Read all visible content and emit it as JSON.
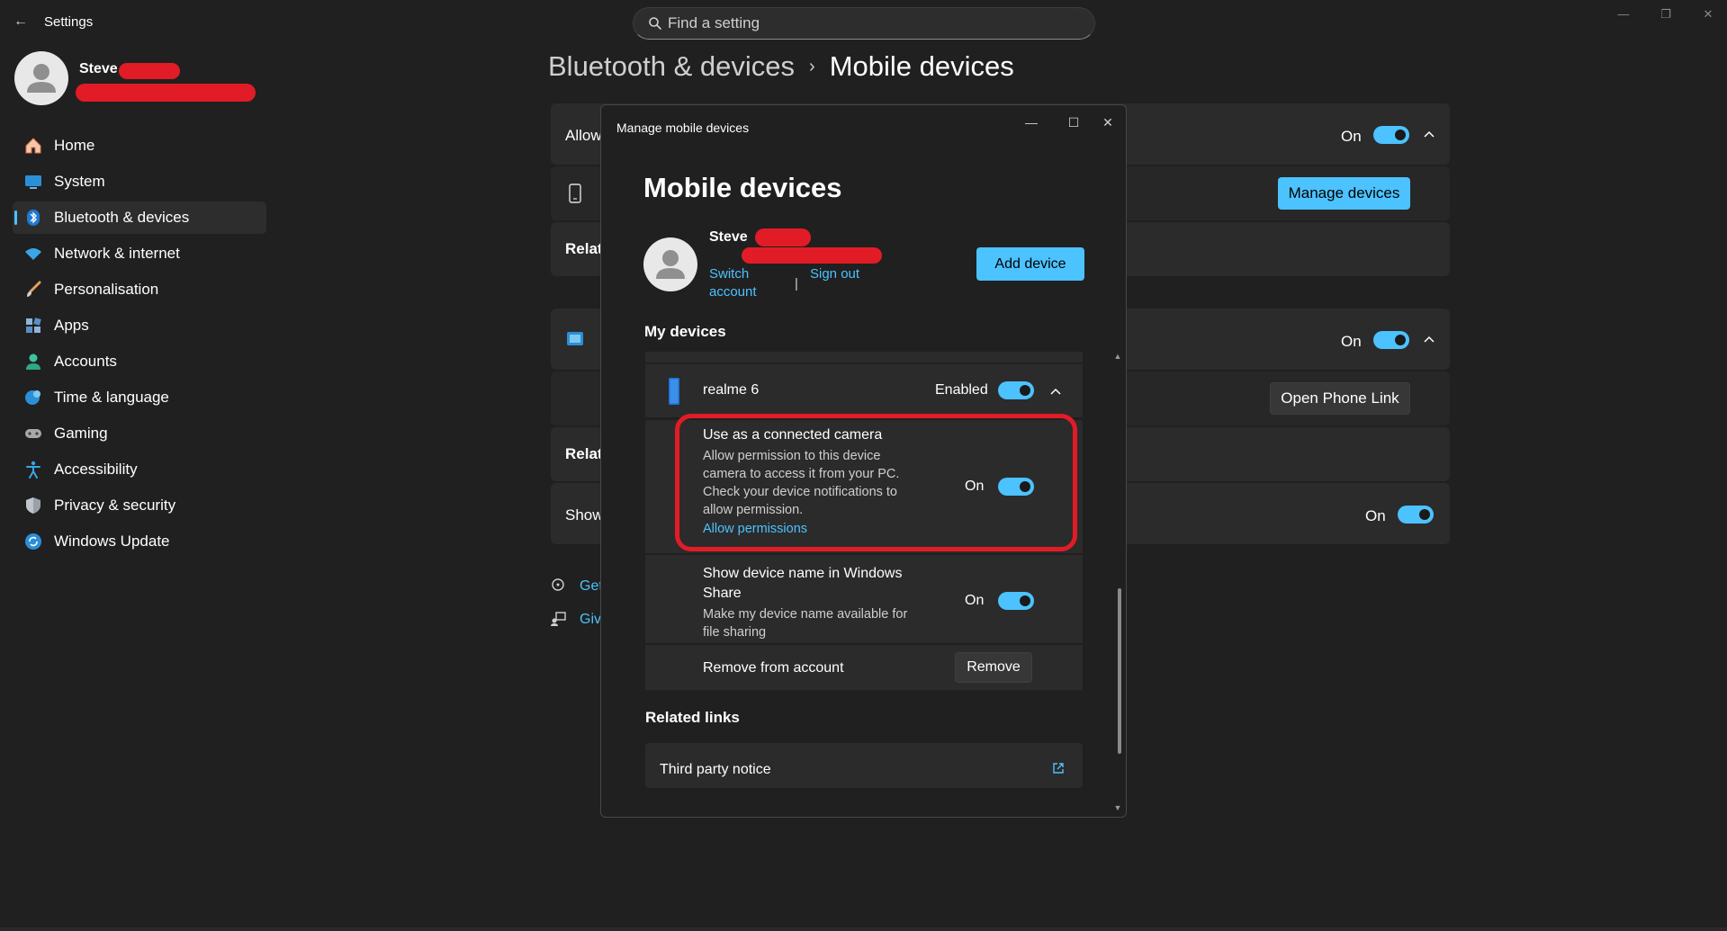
{
  "window": {
    "title": "Settings",
    "search_placeholder": "Find a setting"
  },
  "user": {
    "name": "Steve"
  },
  "sidebar": {
    "items": [
      {
        "label": "Home",
        "icon": "home-icon"
      },
      {
        "label": "System",
        "icon": "system-icon"
      },
      {
        "label": "Bluetooth & devices",
        "icon": "bluetooth-icon"
      },
      {
        "label": "Network & internet",
        "icon": "wifi-icon"
      },
      {
        "label": "Personalisation",
        "icon": "brush-icon"
      },
      {
        "label": "Apps",
        "icon": "apps-icon"
      },
      {
        "label": "Accounts",
        "icon": "accounts-icon"
      },
      {
        "label": "Time & language",
        "icon": "globe-clock-icon"
      },
      {
        "label": "Gaming",
        "icon": "gamepad-icon"
      },
      {
        "label": "Accessibility",
        "icon": "accessibility-icon"
      },
      {
        "label": "Privacy & security",
        "icon": "shield-icon"
      },
      {
        "label": "Windows Update",
        "icon": "update-icon"
      }
    ],
    "active_index": 2
  },
  "breadcrumb": {
    "parent": "Bluetooth & devices",
    "separator": "›",
    "current": "Mobile devices"
  },
  "main": {
    "card1_label": "Allow",
    "card1_state": "On",
    "manage_devices_button": "Manage devices",
    "related1": "Relat",
    "card2_state": "On",
    "open_phone_link_button": "Open Phone Link",
    "related2": "Relat",
    "card3_label": "Show",
    "card3_state": "On",
    "link_get_help": "Get",
    "link_give_feedback": "Giv"
  },
  "dialog": {
    "window_title": "Manage mobile devices",
    "heading": "Mobile devices",
    "user_name": "Steve",
    "switch_account_line1": "Switch",
    "switch_account_line2": "account",
    "separator": "|",
    "sign_out": "Sign out",
    "add_device_button": "Add device",
    "my_devices_title": "My devices",
    "device": {
      "name": "realme 6",
      "status": "Enabled"
    },
    "camera": {
      "title": "Use as a connected camera",
      "desc_lines": [
        "Allow permission to this device",
        "camera to access it from your PC.",
        "Check your device notifications to",
        "allow permission."
      ],
      "link": "Allow permissions",
      "state": "On"
    },
    "share": {
      "title_line1": "Show device name in Windows",
      "title_line2": "Share",
      "desc_line1": "Make my device name available for",
      "desc_line2": "file sharing",
      "state": "On"
    },
    "remove": {
      "label": "Remove from account",
      "button": "Remove"
    },
    "related_links_title": "Related links",
    "third_party_notice": "Third party notice"
  },
  "colors": {
    "accent": "#4cc2ff",
    "background": "#202020",
    "card": "#2b2b2b",
    "annotation_red": "#e11c26"
  }
}
